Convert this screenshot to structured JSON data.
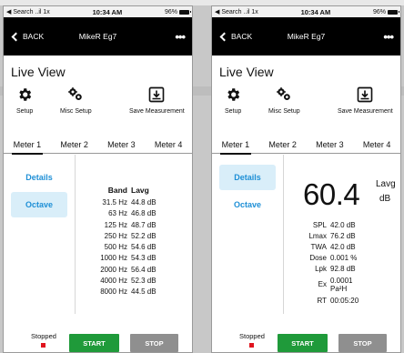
{
  "status": {
    "carrier": "◀ Search ..il 1x",
    "time": "10:34 AM",
    "battery": "96%"
  },
  "nav": {
    "back_label": "BACK",
    "title": "MikeR Eg7",
    "more": "•••"
  },
  "page": {
    "title": "Live View"
  },
  "toolbar": {
    "setup_label": "Setup",
    "misc_setup_label": "Misc Setup",
    "save_label": "Save Measurement"
  },
  "tabs": [
    "Meter 1",
    "Meter 2",
    "Meter 3",
    "Meter 4"
  ],
  "side_nav": {
    "details_label": "Details",
    "octave_label": "Octave"
  },
  "octave": {
    "header_band": "Band",
    "header_value": "Lavg",
    "rows": [
      {
        "band": "31.5 Hz",
        "value": "44.8 dB"
      },
      {
        "band": "63 Hz",
        "value": "46.8 dB"
      },
      {
        "band": "125 Hz",
        "value": "48.7 dB"
      },
      {
        "band": "250 Hz",
        "value": "52.2 dB"
      },
      {
        "band": "500 Hz",
        "value": "54.6 dB"
      },
      {
        "band": "1000 Hz",
        "value": "54.3 dB"
      },
      {
        "band": "2000 Hz",
        "value": "56.4 dB"
      },
      {
        "band": "4000 Hz",
        "value": "52.3 dB"
      },
      {
        "band": "8000 Hz",
        "value": "44.5 dB"
      }
    ]
  },
  "details": {
    "big_value": "60.4",
    "big_metric": "Lavg",
    "big_unit": "dB",
    "metrics": [
      {
        "name": "SPL",
        "value": "42.0 dB"
      },
      {
        "name": "Lmax",
        "value": "76.2 dB"
      },
      {
        "name": "TWA",
        "value": "42.0 dB"
      },
      {
        "name": "Dose",
        "value": "0.001 %"
      },
      {
        "name": "Lpk",
        "value": "92.8 dB"
      },
      {
        "name": "Ex",
        "value": "0.0001",
        "value2": "Pa²H"
      },
      {
        "name": "RT",
        "value": "00:05:20"
      }
    ]
  },
  "bottom": {
    "status_label": "Stopped",
    "start_label": "START",
    "stop_label": "STOP"
  },
  "colors": {
    "accent": "#1e8fd6",
    "active_side_bg": "#d9eef9",
    "start": "#1f9a3a",
    "stop": "#8f8f8f",
    "stopped_indicator": "#e0141e"
  }
}
